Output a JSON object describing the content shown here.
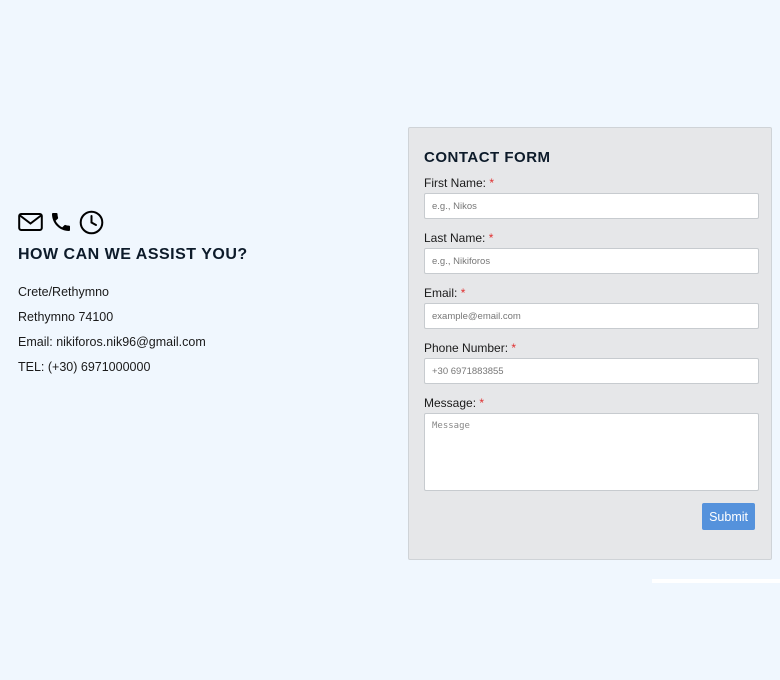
{
  "contact_info": {
    "icons": [
      "envelope-icon",
      "phone-icon",
      "clock-icon"
    ],
    "title": "HOW CAN WE ASSIST YOU?",
    "lines": [
      "Crete/Rethymno",
      "Rethymno 74100",
      "Email: nikiforos.nik96@gmail.com",
      "TEL: (+30) 6971000000"
    ]
  },
  "form": {
    "title": "CONTACT FORM",
    "required_mark": "*",
    "fields": {
      "first_name": {
        "label": "First Name:",
        "placeholder": "e.g., Nikos"
      },
      "last_name": {
        "label": "Last Name:",
        "placeholder": "e.g., Nikiforos"
      },
      "email": {
        "label": "Email:",
        "placeholder": "example@email.com"
      },
      "phone": {
        "label": "Phone Number:",
        "placeholder": "+30 6971883855"
      },
      "message": {
        "label": "Message:",
        "placeholder": "Message"
      }
    },
    "submit_label": "Submit"
  },
  "colors": {
    "background": "#f0f7fe",
    "card": "#e6e7e9",
    "accent": "#5592dc",
    "required": "#e03030"
  }
}
